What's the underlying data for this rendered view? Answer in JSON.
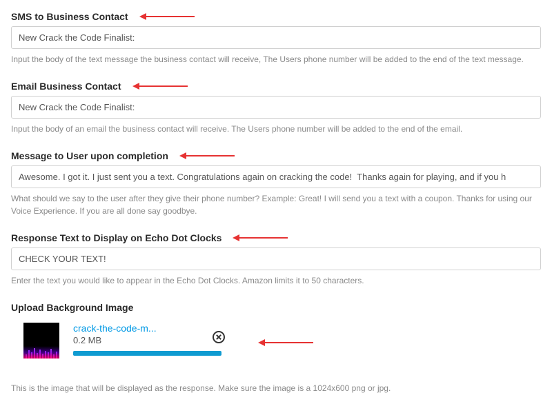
{
  "fields": {
    "sms": {
      "label": "SMS to Business Contact",
      "value": "New Crack the Code Finalist:",
      "help": "Input the body of the text message the business contact will receive, The Users phone number will be added to the end of the text message."
    },
    "email": {
      "label": "Email Business Contact",
      "value": "New Crack the Code Finalist:",
      "help": "Input the body of an email the business contact will receive. The Users phone number will be added to the end of the email."
    },
    "completion": {
      "label": "Message to User upon completion",
      "value": "Awesome. I got it. I just sent you a text. Congratulations again on cracking the code!  Thanks again for playing, and if you h",
      "help": "What should we say to the user after they give their phone number? Example: Great! I will send you a text with a coupon. Thanks for using our Voice Experience. If you are all done say goodbye."
    },
    "echo": {
      "label": "Response Text to Display on Echo Dot Clocks",
      "value": "CHECK YOUR TEXT!",
      "help": "Enter the text you would like to appear in the Echo Dot Clocks. Amazon limits it to 50 characters."
    },
    "upload": {
      "label": "Upload Background Image",
      "filename": "crack-the-code-m...",
      "size": "0.2 MB",
      "footer": "This is the image that will be displayed as the response. Make sure the image is a 1024x600 png or jpg."
    }
  },
  "annotations": {
    "arrow_color": "#e63232"
  }
}
